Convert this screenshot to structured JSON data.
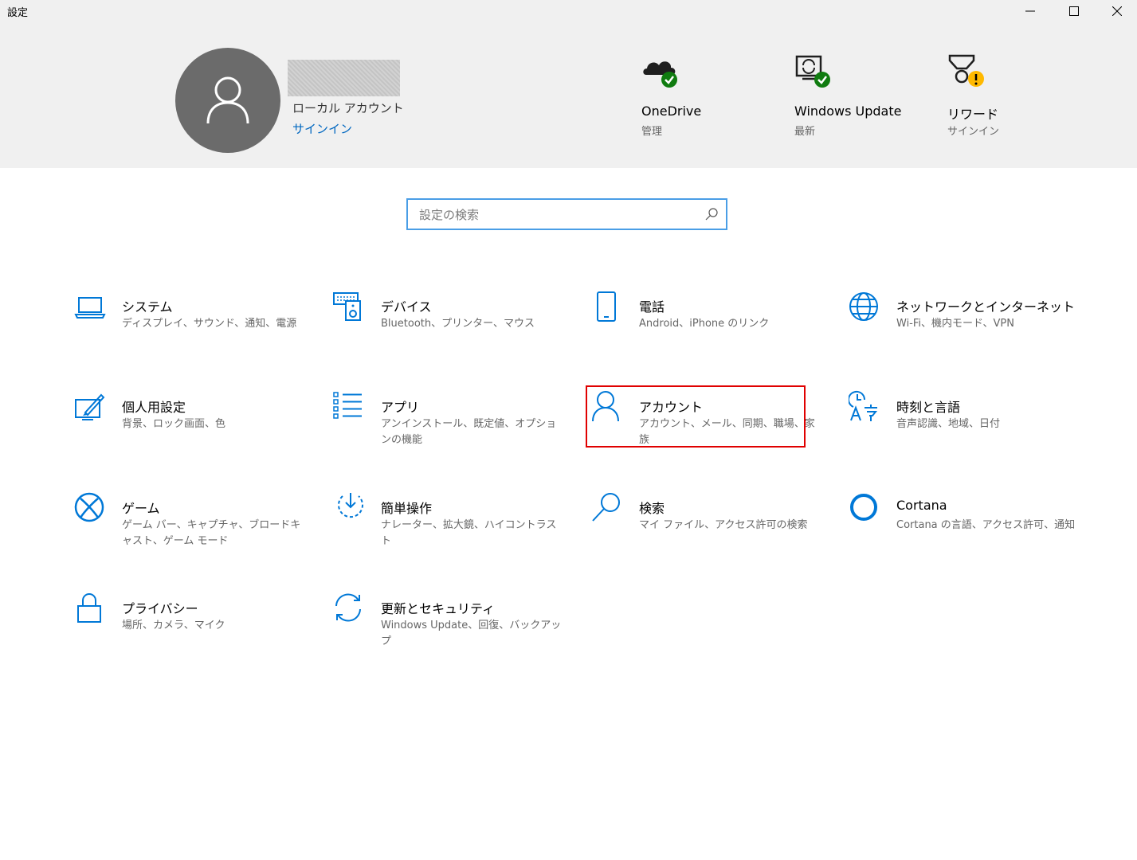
{
  "window": {
    "title": "設定",
    "controls": [
      "minimize",
      "maximize",
      "close"
    ]
  },
  "account": {
    "type": "ローカル アカウント",
    "signin_link": "サインイン"
  },
  "status_tiles": [
    {
      "label": "OneDrive",
      "sub": "管理",
      "icon": "onedrive-icon",
      "badge": "ok"
    },
    {
      "label": "Windows Update",
      "sub": "最新",
      "icon": "windows-update-icon",
      "badge": "ok"
    },
    {
      "label": "リワード",
      "sub": "サインイン",
      "icon": "rewards-icon",
      "badge": "warning"
    }
  ],
  "search": {
    "placeholder": "設定の検索",
    "value": ""
  },
  "categories": [
    {
      "title": "システム",
      "desc": "ディスプレイ、サウンド、通知、電源",
      "icon": "laptop-icon"
    },
    {
      "title": "デバイス",
      "desc": "Bluetooth、プリンター、マウス",
      "icon": "devices-icon"
    },
    {
      "title": "電話",
      "desc": "Android、iPhone のリンク",
      "icon": "phone-icon"
    },
    {
      "title": "ネットワークとインターネット",
      "desc": "Wi-Fi、機内モード、VPN",
      "icon": "globe-icon"
    },
    {
      "title": "個人用設定",
      "desc": "背景、ロック画面、色",
      "icon": "personalization-icon"
    },
    {
      "title": "アプリ",
      "desc": "アンインストール、既定値、オプションの機能",
      "icon": "apps-list-icon"
    },
    {
      "title": "アカウント",
      "desc": "アカウント、メール、同期、職場、家族",
      "icon": "person-icon",
      "highlighted": true
    },
    {
      "title": "時刻と言語",
      "desc": "音声認識、地域、日付",
      "icon": "time-language-icon"
    },
    {
      "title": "ゲーム",
      "desc": "ゲーム バー、キャプチャ、ブロードキャスト、ゲーム モード",
      "icon": "xbox-icon"
    },
    {
      "title": "簡単操作",
      "desc": "ナレーター、拡大鏡、ハイコントラスト",
      "icon": "ease-of-access-icon"
    },
    {
      "title": "検索",
      "desc": "マイ ファイル、アクセス許可の検索",
      "icon": "search-icon"
    },
    {
      "title": "Cortana",
      "desc": "Cortana の言語、アクセス許可、通知",
      "icon": "cortana-icon"
    },
    {
      "title": "プライバシー",
      "desc": "場所、カメラ、マイク",
      "icon": "lock-icon"
    },
    {
      "title": "更新とセキュリティ",
      "desc": "Windows Update、回復、バックアップ",
      "icon": "update-security-icon"
    }
  ],
  "colors": {
    "accent": "#0078d7",
    "link": "#0067c0",
    "header_bg": "#f0f0f0",
    "highlight_border": "#e00000",
    "ok_badge": "#107c10",
    "warning_badge": "#ffb900"
  }
}
